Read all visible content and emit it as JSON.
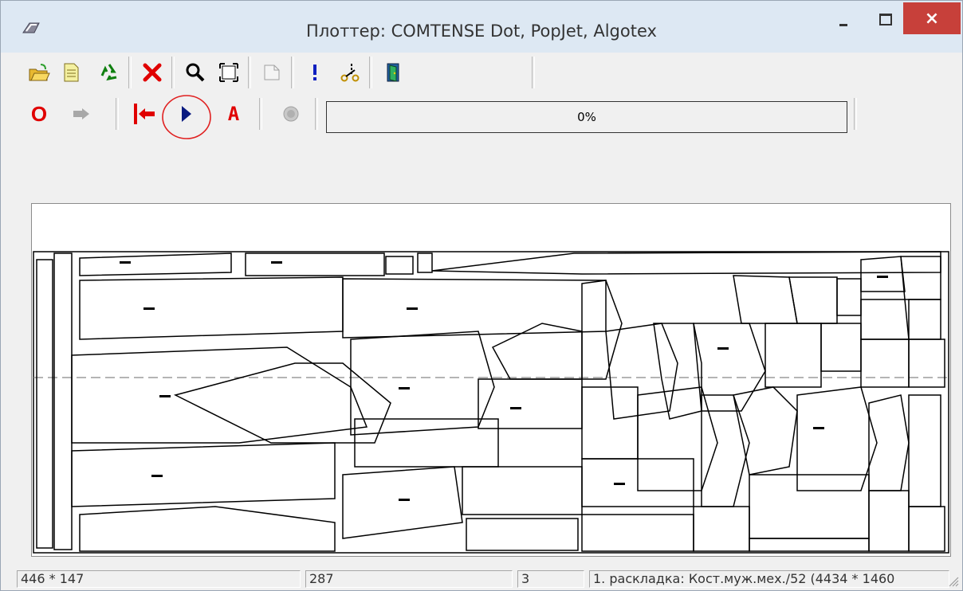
{
  "window": {
    "title": "Плоттер: COMTENSE Dot, PopJet, Algotex",
    "close_label": "×"
  },
  "toolbar1": [
    {
      "name": "open-file-icon"
    },
    {
      "name": "document-icon"
    },
    {
      "name": "recycle-icon"
    },
    {
      "name": "delete-icon"
    },
    {
      "name": "zoom-icon"
    },
    {
      "name": "fit-page-icon"
    },
    {
      "name": "page-disabled-icon"
    },
    {
      "name": "exclamation-icon"
    },
    {
      "name": "cut-scissors-icon"
    },
    {
      "name": "exit-door-icon"
    }
  ],
  "toolbar2": [
    {
      "name": "reset-o-icon",
      "label": "O"
    },
    {
      "name": "forward-disabled-icon"
    },
    {
      "name": "go-to-start-icon"
    },
    {
      "name": "play-icon"
    },
    {
      "name": "letter-a-icon",
      "label": "A"
    },
    {
      "name": "stop-disabled-icon"
    }
  ],
  "progress": {
    "percent": 0,
    "text": "0%"
  },
  "status": {
    "coords": "446 *  147",
    "count": "287",
    "number": "3",
    "layout": "1. раскладка: Кост.муж.мех./52 (4434 * 1460"
  },
  "colors": {
    "accent_red": "#e00000",
    "play_blue": "#0a1a80",
    "highlight_circle": "#e02020",
    "close_red": "#c7403a"
  }
}
